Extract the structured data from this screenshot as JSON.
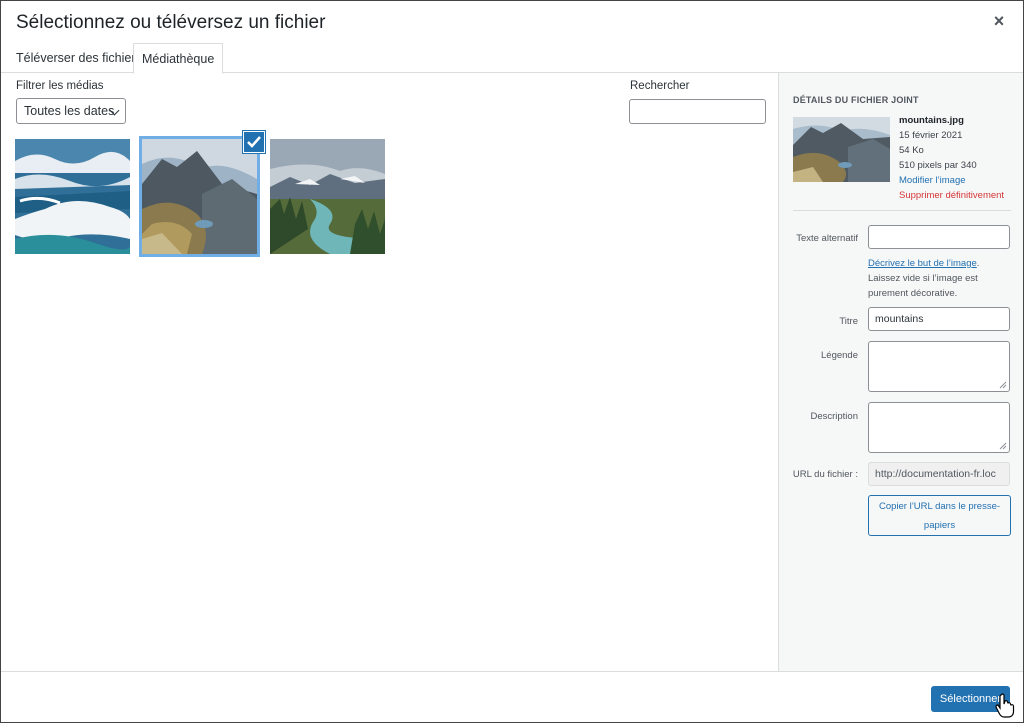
{
  "dialog": {
    "title": "Sélectionnez ou téléversez un fichier",
    "close_label": "×"
  },
  "tabs": [
    {
      "label": "Téléverser des fichiers",
      "active": false
    },
    {
      "label": "Médiathèque",
      "active": true
    }
  ],
  "filters": {
    "label": "Filtrer les médias",
    "date_selected": "Toutes les dates",
    "search_label": "Rechercher",
    "search_value": ""
  },
  "attachments": [
    {
      "name": "waves-icon",
      "selected": false
    },
    {
      "name": "mountains-icon",
      "selected": true
    },
    {
      "name": "lake-icon",
      "selected": false
    }
  ],
  "details": {
    "heading": "DÉTAILS DU FICHIER JOINT",
    "filename": "mountains.jpg",
    "date": "15 février 2021",
    "size": "54 Ko",
    "dimensions": "510 pixels par 340",
    "edit_link": "Modifier l’image",
    "delete_link": "Supprimer définitivement"
  },
  "fields": {
    "alt_label": "Texte alternatif",
    "alt_value": "",
    "alt_help_link": "Décrivez le but de l’image",
    "alt_help_text": ". Laissez vide si l’image est purement décorative.",
    "title_label": "Titre",
    "title_value": "mountains",
    "caption_label": "Légende",
    "caption_value": "",
    "description_label": "Description",
    "description_value": "",
    "url_label": "URL du fichier :",
    "url_value": "http://documentation-fr.loc",
    "copy_button": "Copier l’URL dans le presse-papiers"
  },
  "footer": {
    "select_button": "Sélectionner"
  },
  "colors": {
    "primary": "#2271b1",
    "danger": "#d63638",
    "selection": "#72aee6"
  }
}
